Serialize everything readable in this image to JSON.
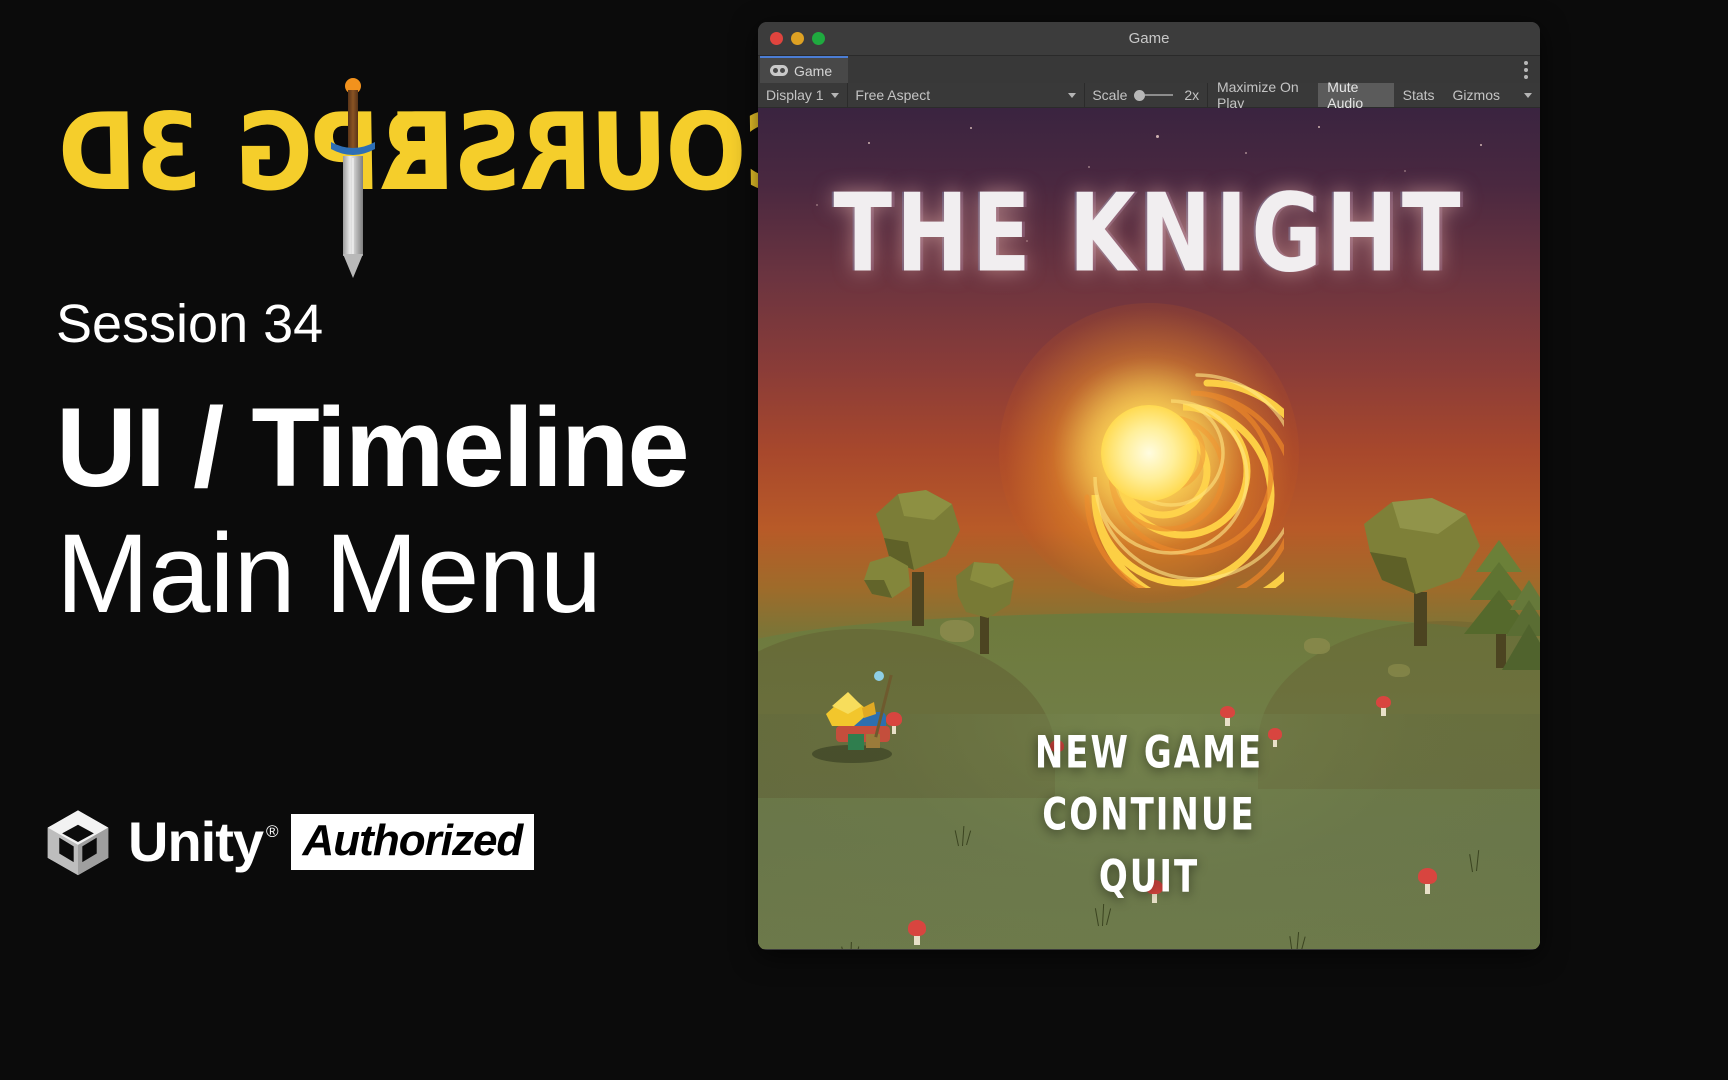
{
  "left_panel": {
    "course_logo": {
      "word_1": "3D",
      "word_2": "RPG",
      "word_3": "COURSE",
      "sword_icon": "sword-icon"
    },
    "session_label": "Session 34",
    "title_line_1": "UI / Timeline",
    "title_line_2": "Main Menu",
    "unity_lockup": {
      "cube_icon": "unity-cube-icon",
      "wordmark": "Unity",
      "registered_mark": "®",
      "badge": "Authorized"
    },
    "background_color": "#0b0b0b",
    "accent_color": "#F5CE2B"
  },
  "game_window": {
    "title": "Game",
    "traffic_lights": {
      "close": "#e0443e",
      "minimize": "#dea123",
      "zoom": "#1faa3f"
    },
    "tab": {
      "label": "Game",
      "icon": "gamepad-icon",
      "active_accent": "#4b7dd4"
    },
    "kebab_menu": "kebab-menu-icon",
    "toolbar": {
      "display_select": "Display 1",
      "aspect_select": "Free Aspect",
      "scale_label": "Scale",
      "scale_value": "2x",
      "maximize_on_play": "Maximize On Play",
      "mute_audio": "Mute Audio",
      "stats": "Stats",
      "gizmos": "Gizmos",
      "gizmos_caret": "chevron-down-icon"
    }
  },
  "game_view": {
    "game_title": "THE KNIGHT",
    "menu_items": [
      {
        "label": "NEW GAME"
      },
      {
        "label": "CONTINUE"
      },
      {
        "label": "QUIT"
      }
    ],
    "scene": {
      "vortex": "glowing-spiral-portal",
      "sky_top_color": "#3a2440",
      "sky_mid_color": "#a8482c",
      "ground_color": "#6e7a3c",
      "vortex_core_color": "#ffef9a"
    }
  }
}
